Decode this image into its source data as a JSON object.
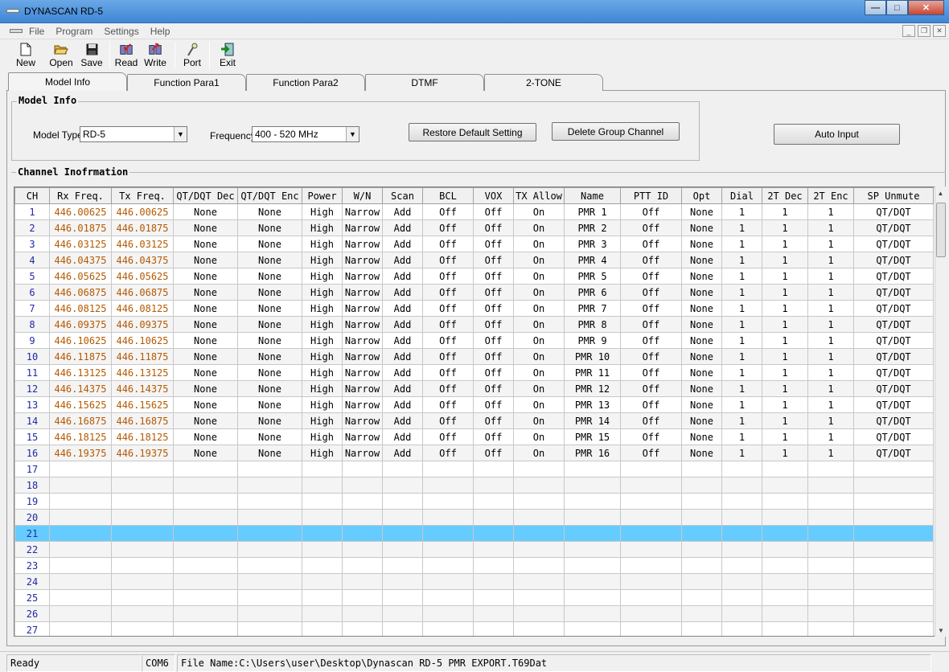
{
  "window": {
    "title": "DYNASCAN RD-5",
    "min": "—",
    "max": "□",
    "close": "✕"
  },
  "menu": [
    "File",
    "Program",
    "Settings",
    "Help"
  ],
  "toolbar": [
    {
      "label": "New",
      "icon": "new-file-icon"
    },
    {
      "label": "Open",
      "icon": "open-folder-icon"
    },
    {
      "label": "Save",
      "icon": "save-disk-icon"
    },
    {
      "label": "Read",
      "icon": "read-radio-icon"
    },
    {
      "label": "Write",
      "icon": "write-radio-icon"
    },
    {
      "label": "Port",
      "icon": "port-icon"
    },
    {
      "label": "Exit",
      "icon": "exit-icon"
    }
  ],
  "tabs": [
    "Model Info",
    "Function Para1",
    "Function Para2",
    "DTMF",
    "2-TONE"
  ],
  "model_info": {
    "title": "Model Info",
    "model_type_label": "Model Type",
    "model_type_value": "RD-5",
    "frequency_label": "Frequency",
    "frequency_value": "400 - 520 MHz",
    "restore_button": "Restore Default Setting",
    "delete_button": "Delete Group Channel",
    "auto_input_button": "Auto Input"
  },
  "channel_info": {
    "title": "Channel Inofrmation",
    "columns": [
      "CH",
      "Rx Freq.",
      "Tx Freq.",
      "QT/DQT Dec",
      "QT/DQT Enc",
      "Power",
      "W/N",
      "Scan",
      "BCL",
      "VOX",
      "TX Allow",
      "Name",
      "PTT ID",
      "Opt",
      "Dial",
      "2T Dec",
      "2T Enc",
      "SP Unmute"
    ],
    "rows": [
      [
        "1",
        "446.00625",
        "446.00625",
        "None",
        "None",
        "High",
        "Narrow",
        "Add",
        "Off",
        "Off",
        "On",
        "PMR 1",
        "Off",
        "None",
        "1",
        "1",
        "1",
        "QT/DQT"
      ],
      [
        "2",
        "446.01875",
        "446.01875",
        "None",
        "None",
        "High",
        "Narrow",
        "Add",
        "Off",
        "Off",
        "On",
        "PMR 2",
        "Off",
        "None",
        "1",
        "1",
        "1",
        "QT/DQT"
      ],
      [
        "3",
        "446.03125",
        "446.03125",
        "None",
        "None",
        "High",
        "Narrow",
        "Add",
        "Off",
        "Off",
        "On",
        "PMR 3",
        "Off",
        "None",
        "1",
        "1",
        "1",
        "QT/DQT"
      ],
      [
        "4",
        "446.04375",
        "446.04375",
        "None",
        "None",
        "High",
        "Narrow",
        "Add",
        "Off",
        "Off",
        "On",
        "PMR 4",
        "Off",
        "None",
        "1",
        "1",
        "1",
        "QT/DQT"
      ],
      [
        "5",
        "446.05625",
        "446.05625",
        "None",
        "None",
        "High",
        "Narrow",
        "Add",
        "Off",
        "Off",
        "On",
        "PMR 5",
        "Off",
        "None",
        "1",
        "1",
        "1",
        "QT/DQT"
      ],
      [
        "6",
        "446.06875",
        "446.06875",
        "None",
        "None",
        "High",
        "Narrow",
        "Add",
        "Off",
        "Off",
        "On",
        "PMR 6",
        "Off",
        "None",
        "1",
        "1",
        "1",
        "QT/DQT"
      ],
      [
        "7",
        "446.08125",
        "446.08125",
        "None",
        "None",
        "High",
        "Narrow",
        "Add",
        "Off",
        "Off",
        "On",
        "PMR 7",
        "Off",
        "None",
        "1",
        "1",
        "1",
        "QT/DQT"
      ],
      [
        "8",
        "446.09375",
        "446.09375",
        "None",
        "None",
        "High",
        "Narrow",
        "Add",
        "Off",
        "Off",
        "On",
        "PMR 8",
        "Off",
        "None",
        "1",
        "1",
        "1",
        "QT/DQT"
      ],
      [
        "9",
        "446.10625",
        "446.10625",
        "None",
        "None",
        "High",
        "Narrow",
        "Add",
        "Off",
        "Off",
        "On",
        "PMR 9",
        "Off",
        "None",
        "1",
        "1",
        "1",
        "QT/DQT"
      ],
      [
        "10",
        "446.11875",
        "446.11875",
        "None",
        "None",
        "High",
        "Narrow",
        "Add",
        "Off",
        "Off",
        "On",
        "PMR 10",
        "Off",
        "None",
        "1",
        "1",
        "1",
        "QT/DQT"
      ],
      [
        "11",
        "446.13125",
        "446.13125",
        "None",
        "None",
        "High",
        "Narrow",
        "Add",
        "Off",
        "Off",
        "On",
        "PMR 11",
        "Off",
        "None",
        "1",
        "1",
        "1",
        "QT/DQT"
      ],
      [
        "12",
        "446.14375",
        "446.14375",
        "None",
        "None",
        "High",
        "Narrow",
        "Add",
        "Off",
        "Off",
        "On",
        "PMR 12",
        "Off",
        "None",
        "1",
        "1",
        "1",
        "QT/DQT"
      ],
      [
        "13",
        "446.15625",
        "446.15625",
        "None",
        "None",
        "High",
        "Narrow",
        "Add",
        "Off",
        "Off",
        "On",
        "PMR 13",
        "Off",
        "None",
        "1",
        "1",
        "1",
        "QT/DQT"
      ],
      [
        "14",
        "446.16875",
        "446.16875",
        "None",
        "None",
        "High",
        "Narrow",
        "Add",
        "Off",
        "Off",
        "On",
        "PMR 14",
        "Off",
        "None",
        "1",
        "1",
        "1",
        "QT/DQT"
      ],
      [
        "15",
        "446.18125",
        "446.18125",
        "None",
        "None",
        "High",
        "Narrow",
        "Add",
        "Off",
        "Off",
        "On",
        "PMR 15",
        "Off",
        "None",
        "1",
        "1",
        "1",
        "QT/DQT"
      ],
      [
        "16",
        "446.19375",
        "446.19375",
        "None",
        "None",
        "High",
        "Narrow",
        "Add",
        "Off",
        "Off",
        "On",
        "PMR 16",
        "Off",
        "None",
        "1",
        "1",
        "1",
        "QT/DQT"
      ],
      [
        "17",
        "",
        "",
        "",
        "",
        "",
        "",
        "",
        "",
        "",
        "",
        "",
        "",
        "",
        "",
        "",
        "",
        ""
      ],
      [
        "18",
        "",
        "",
        "",
        "",
        "",
        "",
        "",
        "",
        "",
        "",
        "",
        "",
        "",
        "",
        "",
        "",
        ""
      ],
      [
        "19",
        "",
        "",
        "",
        "",
        "",
        "",
        "",
        "",
        "",
        "",
        "",
        "",
        "",
        "",
        "",
        "",
        ""
      ],
      [
        "20",
        "",
        "",
        "",
        "",
        "",
        "",
        "",
        "",
        "",
        "",
        "",
        "",
        "",
        "",
        "",
        "",
        ""
      ],
      [
        "21",
        "",
        "",
        "",
        "",
        "",
        "",
        "",
        "",
        "",
        "",
        "",
        "",
        "",
        "",
        "",
        "",
        ""
      ],
      [
        "22",
        "",
        "",
        "",
        "",
        "",
        "",
        "",
        "",
        "",
        "",
        "",
        "",
        "",
        "",
        "",
        "",
        ""
      ],
      [
        "23",
        "",
        "",
        "",
        "",
        "",
        "",
        "",
        "",
        "",
        "",
        "",
        "",
        "",
        "",
        "",
        "",
        ""
      ],
      [
        "24",
        "",
        "",
        "",
        "",
        "",
        "",
        "",
        "",
        "",
        "",
        "",
        "",
        "",
        "",
        "",
        "",
        ""
      ],
      [
        "25",
        "",
        "",
        "",
        "",
        "",
        "",
        "",
        "",
        "",
        "",
        "",
        "",
        "",
        "",
        "",
        "",
        ""
      ],
      [
        "26",
        "",
        "",
        "",
        "",
        "",
        "",
        "",
        "",
        "",
        "",
        "",
        "",
        "",
        "",
        "",
        "",
        ""
      ],
      [
        "27",
        "",
        "",
        "",
        "",
        "",
        "",
        "",
        "",
        "",
        "",
        "",
        "",
        "",
        "",
        "",
        "",
        ""
      ]
    ],
    "selected_channel": "21"
  },
  "statusbar": {
    "status": "Ready",
    "port": "COM6",
    "file": "File Name:C:\\Users\\user\\Desktop\\Dynascan RD-5 PMR EXPORT.T69Dat"
  },
  "colors": {
    "title_bar": "#3f86d6",
    "selected_row": "#66ccff",
    "channel_number": "#1f2aa8",
    "frequency": "#b55a00"
  }
}
